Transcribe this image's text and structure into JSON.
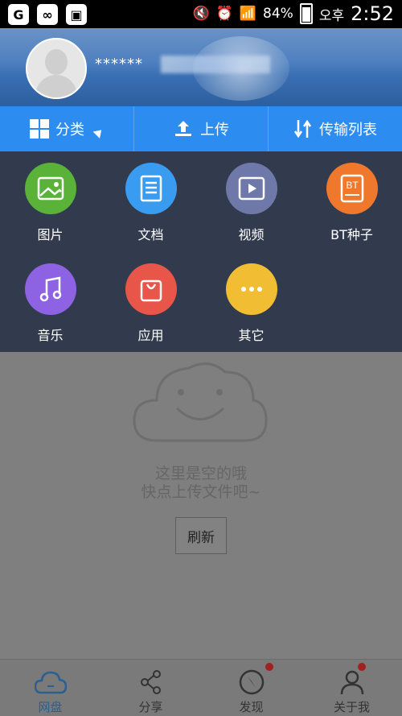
{
  "statusbar": {
    "battery": "84%",
    "time_prefix": "오후",
    "time": "2:52"
  },
  "user": {
    "name": "******"
  },
  "toolbar": {
    "category": "分类",
    "upload": "上传",
    "transfer": "传输列表"
  },
  "categories": [
    {
      "label": "图片",
      "color": "#5ab238",
      "icon": "image-icon"
    },
    {
      "label": "文档",
      "color": "#3a9cf0",
      "icon": "document-icon"
    },
    {
      "label": "视频",
      "color": "#6f79a9",
      "icon": "video-icon"
    },
    {
      "label": "BT种子",
      "color": "#f0782c",
      "icon": "bt-icon"
    },
    {
      "label": "音乐",
      "color": "#8e63e3",
      "icon": "music-icon"
    },
    {
      "label": "应用",
      "color": "#e8564a",
      "icon": "app-icon"
    },
    {
      "label": "其它",
      "color": "#f1bd32",
      "icon": "more-icon"
    }
  ],
  "empty": {
    "line1": "这里是空的哦",
    "line2": "快点上传文件吧~",
    "refresh": "刷新"
  },
  "nav": {
    "disk": "网盘",
    "share": "分享",
    "discover": "发现",
    "me": "关于我"
  }
}
